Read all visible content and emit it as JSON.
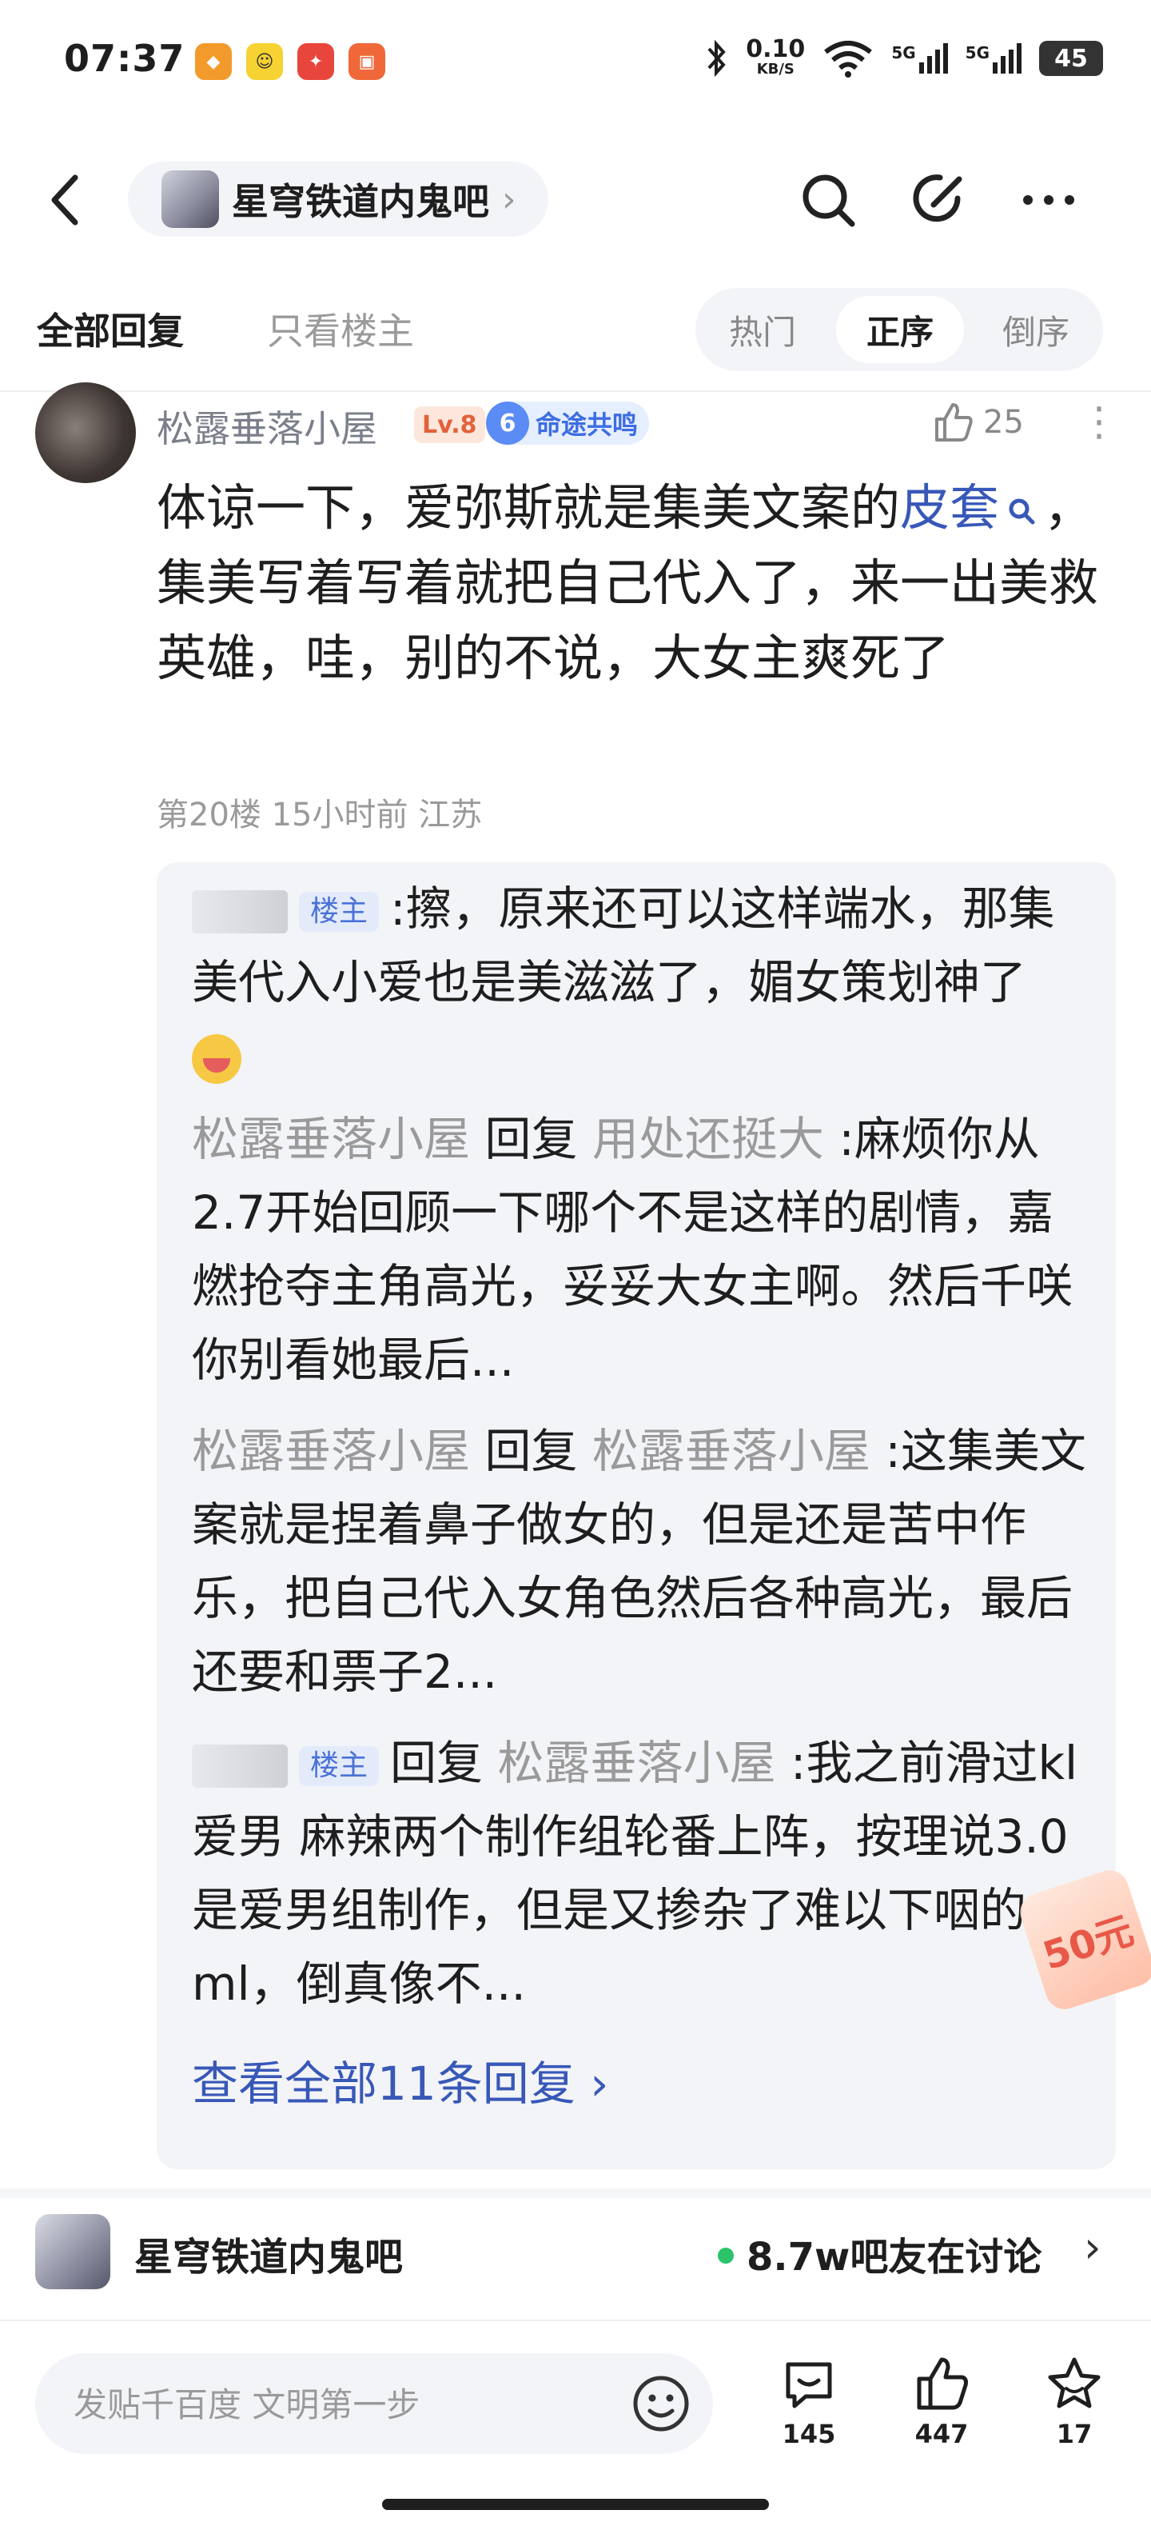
{
  "status_bar": {
    "time": "07:37",
    "net_speed_value": "0.10",
    "net_speed_unit": "KB/S",
    "signal1": "5G",
    "signal2": "5G",
    "battery": "45",
    "app_icons": [
      "app-icon-orange",
      "app-icon-yellow",
      "app-icon-red",
      "app-icon-orange2"
    ]
  },
  "nav": {
    "forum_name": "星穹铁道内鬼吧",
    "icons": [
      "back-icon",
      "search-icon",
      "share-icon",
      "more-icon"
    ]
  },
  "tabs": {
    "all_replies": "全部回复",
    "only_op": "只看楼主",
    "sort": [
      "热门",
      "正序",
      "倒序"
    ],
    "sort_selected": "正序"
  },
  "post": {
    "author": "松露垂落小屋",
    "level": "Lv.8",
    "medal_num": "6",
    "medal_label": "命途共鸣",
    "likes": "25",
    "body_before": "体谅一下，爱弥斯就是集美文案的",
    "body_link": "皮套",
    "body_after": "，集美写着写着就把自己代入了，来一出美救英雄，哇，别的不说，大女主爽死了",
    "meta": "第20楼 15小时前 江苏"
  },
  "replies": [
    {
      "owner_tag": "楼主",
      "text": ":擦，原来还可以这样端水，那集美代入小爱也是美滋滋了，媚女策划神了"
    },
    {
      "from": "松露垂落小屋",
      "verb": "回复",
      "to": "用处还挺大",
      "text": " :麻烦你从2.7开始回顾一下哪个不是这样的剧情，嘉燃抢夺主角高光，妥妥大女主啊。然后千咲你别看她最后..."
    },
    {
      "from": "松露垂落小屋",
      "verb": "回复",
      "to": "松露垂落小屋",
      "text": " :这集美文案就是捏着鼻子做女的，但是还是苦中作乐，把自己代入女角色然后各种高光，最后还要和票子2..."
    },
    {
      "owner_tag": "楼主",
      "verb": "回复",
      "to": "松露垂落小屋",
      "text": " :我之前滑过kl爱男 麻辣两个制作组轮番上阵，按理说3.0是爱男组制作，但是又掺杂了难以下咽的ml，倒真像不..."
    }
  ],
  "view_all": "查看全部11条回复 ›",
  "float_badge": "50元",
  "banner": {
    "forum_name": "星穹铁道内鬼吧",
    "discussing": "8.7w吧友在讨论"
  },
  "bottom_bar": {
    "input_placeholder": "发贴千百度 文明第一步",
    "comments": "145",
    "likes": "447",
    "favorites": "17"
  },
  "colors": {
    "link": "#3858b8",
    "muted": "#9a9a9a",
    "bubble_bg": "#f3f4f7",
    "online_dot": "#2bc46a"
  }
}
